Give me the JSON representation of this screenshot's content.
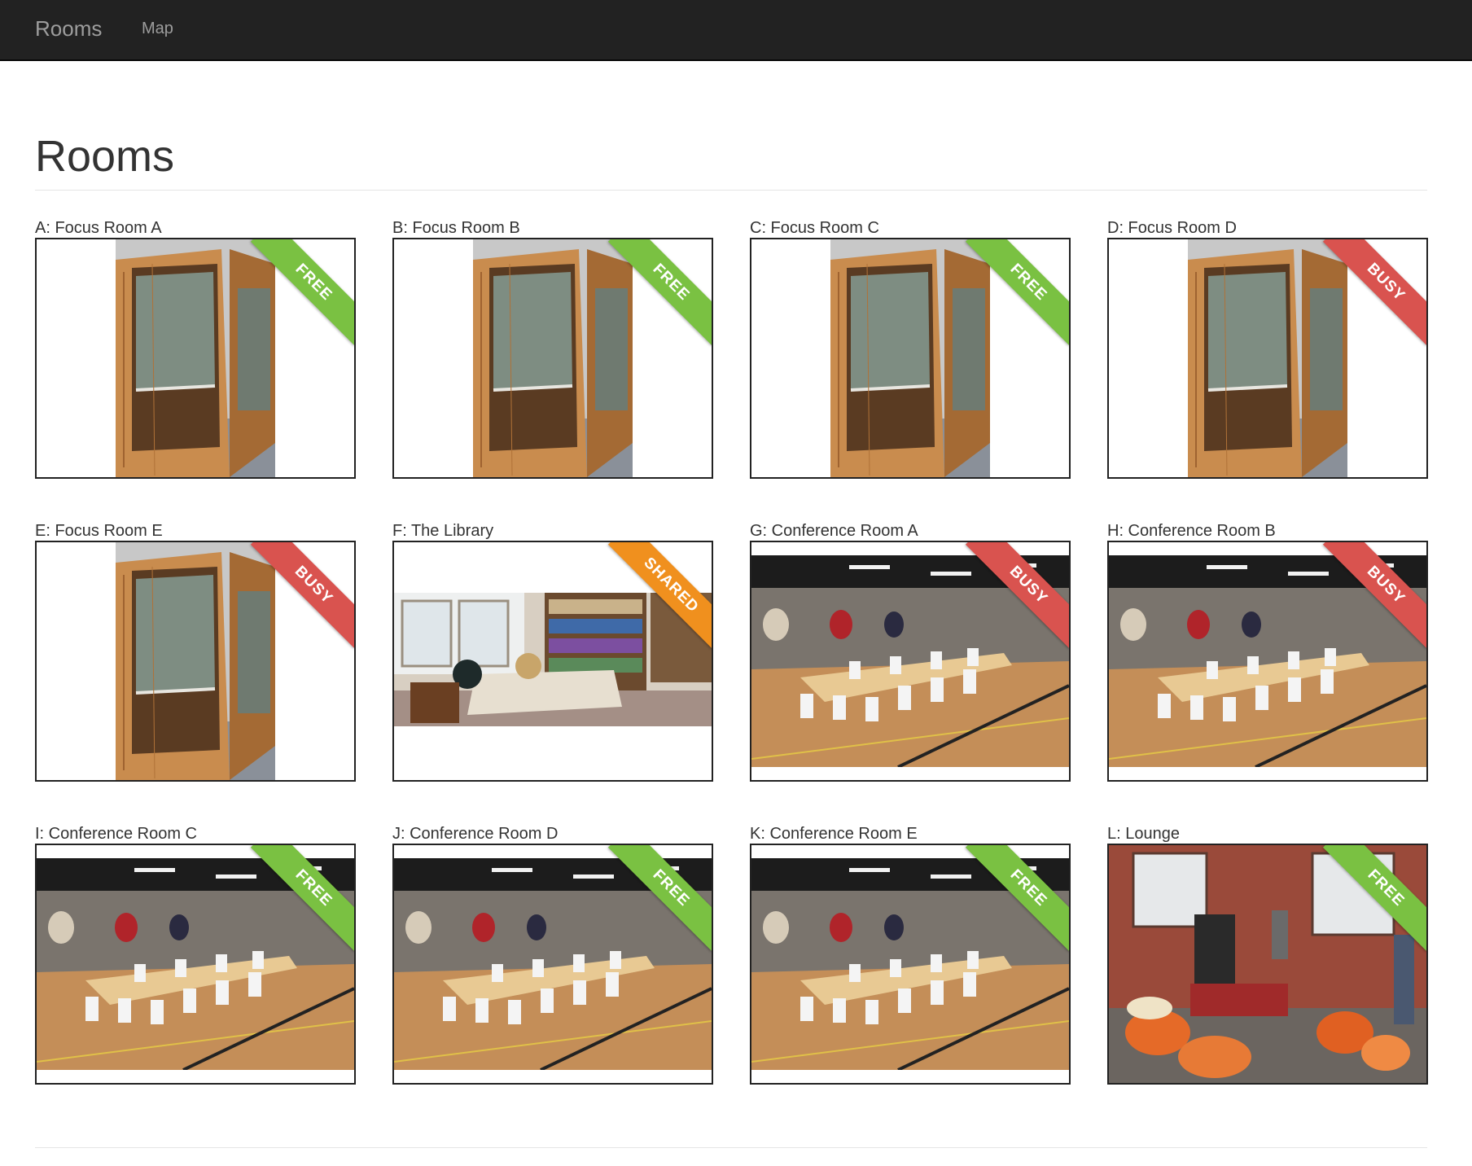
{
  "nav": {
    "brand": "Rooms",
    "links": [
      "Map"
    ]
  },
  "page": {
    "title": "Rooms"
  },
  "status_colors": {
    "FREE": "#7ac142",
    "BUSY": "#d9534f",
    "SHARED": "#f0901e"
  },
  "rooms": [
    {
      "label": "A: Focus Room A",
      "status": "FREE",
      "image": "focus-pod-photo"
    },
    {
      "label": "B: Focus Room B",
      "status": "FREE",
      "image": "focus-pod-photo"
    },
    {
      "label": "C: Focus Room C",
      "status": "FREE",
      "image": "focus-pod-photo"
    },
    {
      "label": "D: Focus Room D",
      "status": "BUSY",
      "image": "focus-pod-photo"
    },
    {
      "label": "E: Focus Room E",
      "status": "BUSY",
      "image": "focus-pod-photo"
    },
    {
      "label": "F: The Library",
      "status": "SHARED",
      "image": "library-photo"
    },
    {
      "label": "G: Conference Room A",
      "status": "BUSY",
      "image": "conference-room-photo"
    },
    {
      "label": "H: Conference Room B",
      "status": "BUSY",
      "image": "conference-room-photo"
    },
    {
      "label": "I: Conference Room C",
      "status": "FREE",
      "image": "conference-room-photo"
    },
    {
      "label": "J: Conference Room D",
      "status": "FREE",
      "image": "conference-room-photo"
    },
    {
      "label": "K: Conference Room E",
      "status": "FREE",
      "image": "conference-room-photo"
    },
    {
      "label": "L: Lounge",
      "status": "FREE",
      "image": "lounge-photo"
    }
  ]
}
